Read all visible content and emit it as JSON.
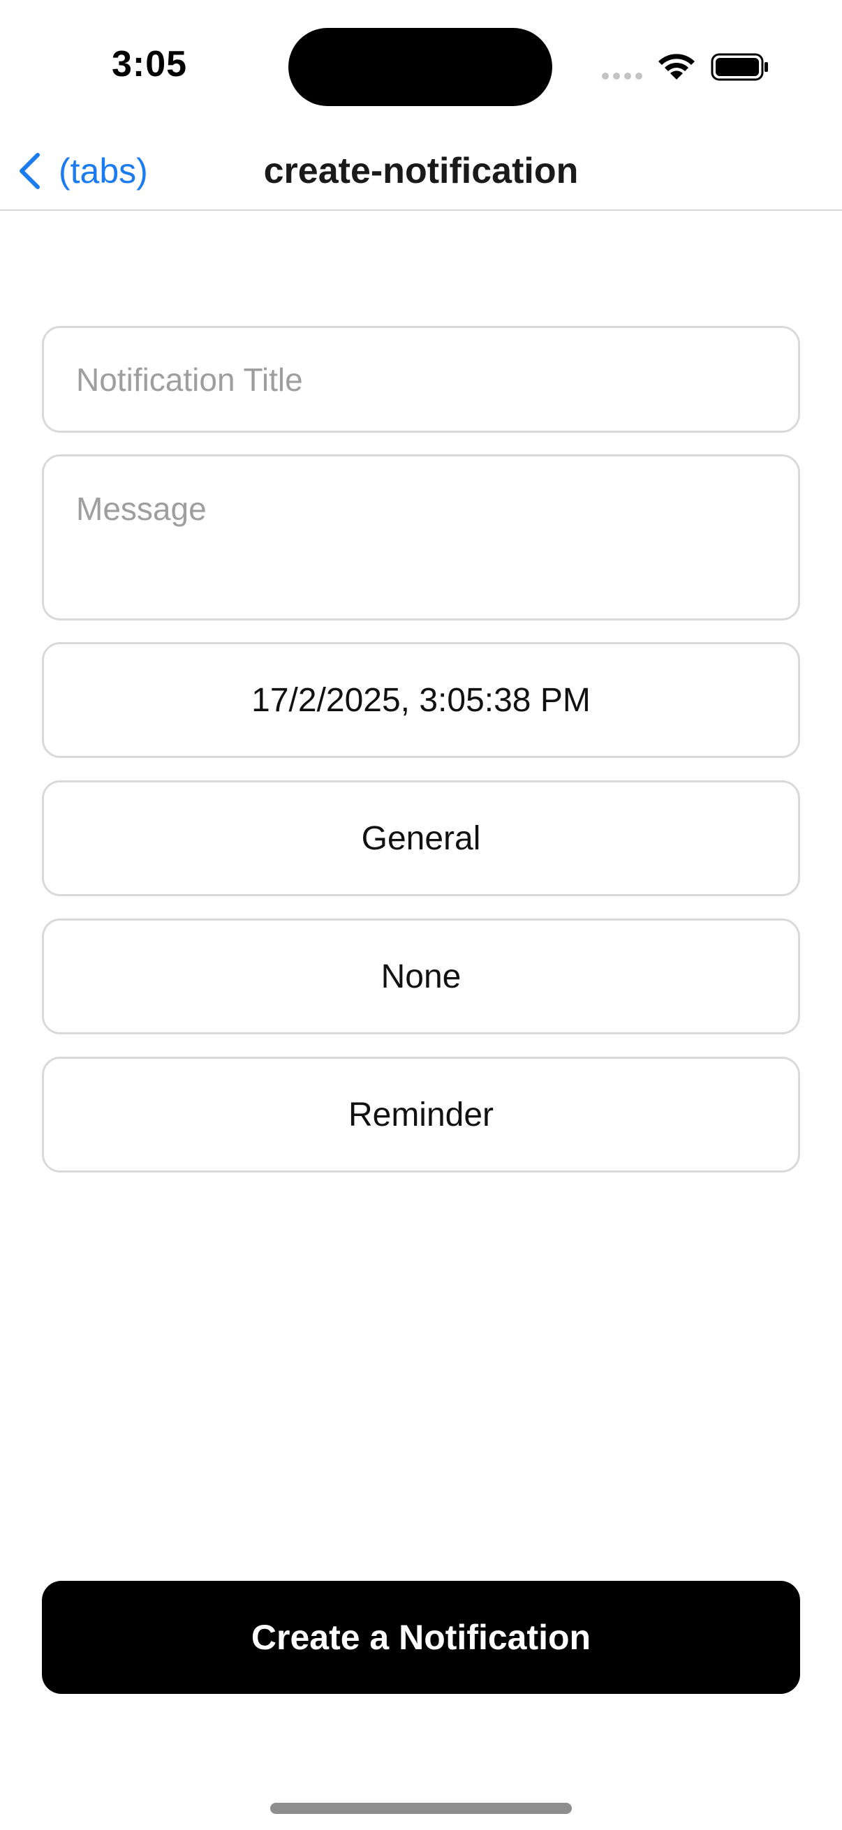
{
  "status_bar": {
    "time": "3:05"
  },
  "nav": {
    "back_label": "(tabs)",
    "title": "create-notification",
    "accent_color": "#1a7cf0"
  },
  "form": {
    "title_placeholder": "Notification Title",
    "title_value": "",
    "message_placeholder": "Message",
    "message_value": "",
    "date_value": "17/2/2025, 3:05:38 PM",
    "category_value": "General",
    "repeat_value": "None",
    "type_value": "Reminder"
  },
  "submit": {
    "label": "Create a Notification"
  },
  "icons": {
    "back": "chevron-left-icon",
    "wifi": "wifi-icon",
    "battery": "battery-icon",
    "signal": "signal-dots-icon"
  }
}
